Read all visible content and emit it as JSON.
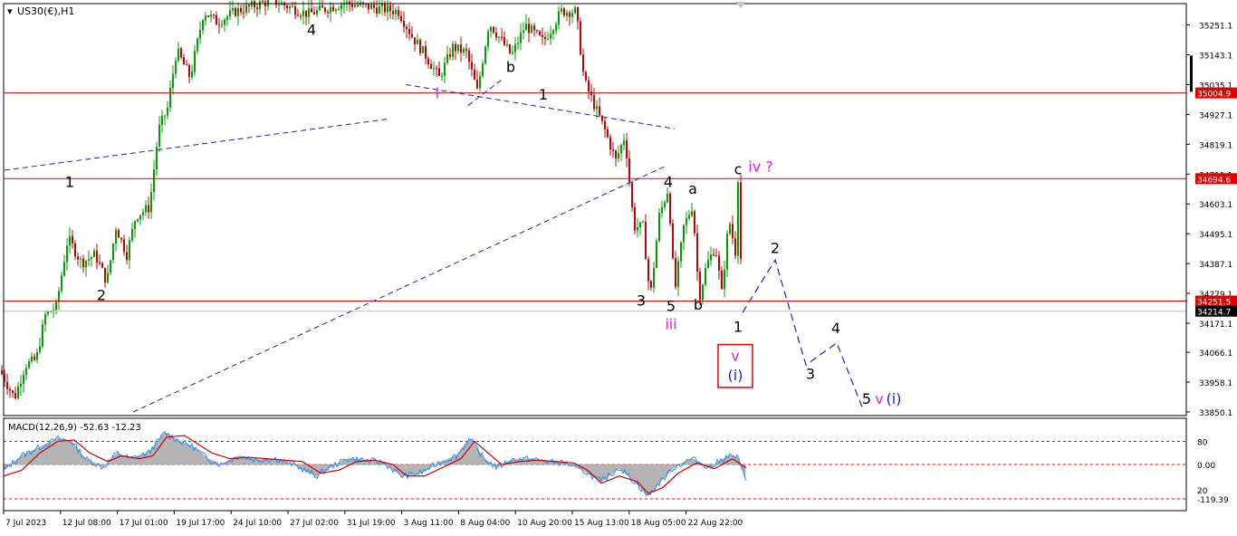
{
  "chart_title": "US30(€),H1",
  "indicator_label": "MACD(12,26,9) -52.63 -12.23",
  "colors": {
    "bull": "#00a000",
    "bear": "#c80000",
    "level_line": "#e00000",
    "trend_line": "#1e1ed2",
    "wave_label": "#000000",
    "wave_label_magenta": "#e020e0",
    "wave_label_blue": "#1e1ed2",
    "macd_hist": "#b4b4b4",
    "macd_line": "#1e90ff",
    "signal_line": "#d00000",
    "macd_level": "#ff0000",
    "frame": "#000000"
  },
  "chart_data": [
    {
      "type": "candlestick",
      "title": "US30(€),H1",
      "ylim": [
        33850,
        35315
      ],
      "y_ticks": [
        "35251.1",
        "35143.1",
        "35035.1",
        "34927.1",
        "34819.1",
        "34711.1",
        "34603.1",
        "34495.1",
        "34387.1",
        "34279.1",
        "34171.1",
        "34066.1",
        "33958.1",
        "33850.1"
      ],
      "x_tick_labels": [
        "7 Jul 2023",
        "12 Jul 08:00",
        "17 Jul 01:00",
        "19 Jul 17:00",
        "24 Jul 10:00",
        "27 Jul 02:00",
        "31 Jul 19:00",
        "3 Aug 11:00",
        "8 Aug 04:00",
        "10 Aug 20:00",
        "15 Aug 13:00",
        "18 Aug 05:00",
        "22 Aug 22:00"
      ],
      "price_path": [
        [
          0,
          34000
        ],
        [
          8,
          33950
        ],
        [
          16,
          33900
        ],
        [
          28,
          34020
        ],
        [
          40,
          34040
        ],
        [
          50,
          34200
        ],
        [
          62,
          34230
        ],
        [
          75,
          34480
        ],
        [
          90,
          34390
        ],
        [
          105,
          34420
        ],
        [
          118,
          34320
        ],
        [
          128,
          34520
        ],
        [
          140,
          34420
        ],
        [
          150,
          34560
        ],
        [
          165,
          34590
        ],
        [
          175,
          34870
        ],
        [
          185,
          34950
        ],
        [
          195,
          35160
        ],
        [
          210,
          35060
        ],
        [
          225,
          35300
        ],
        [
          240,
          35260
        ],
        [
          260,
          35300
        ],
        [
          300,
          35340
        ],
        [
          340,
          35290
        ],
        [
          380,
          35330
        ],
        [
          440,
          35300
        ],
        [
          455,
          35210
        ],
        [
          470,
          35140
        ],
        [
          485,
          35060
        ],
        [
          500,
          35170
        ],
        [
          515,
          35150
        ],
        [
          527,
          35010
        ],
        [
          540,
          35260
        ],
        [
          565,
          35140
        ],
        [
          580,
          35250
        ],
        [
          600,
          35190
        ],
        [
          620,
          35300
        ],
        [
          636,
          35300
        ],
        [
          645,
          35050
        ],
        [
          655,
          34970
        ],
        [
          668,
          34870
        ],
        [
          680,
          34760
        ],
        [
          690,
          34850
        ],
        [
          700,
          34520
        ],
        [
          710,
          34520
        ],
        [
          718,
          34260
        ],
        [
          728,
          34560
        ],
        [
          738,
          34660
        ],
        [
          745,
          34280
        ],
        [
          755,
          34520
        ],
        [
          765,
          34600
        ],
        [
          772,
          34260
        ],
        [
          780,
          34380
        ],
        [
          790,
          34450
        ],
        [
          797,
          34280
        ],
        [
          805,
          34550
        ],
        [
          812,
          34430
        ],
        [
          815,
          34700
        ],
        [
          820,
          34210
        ]
      ],
      "levels": [
        {
          "price": 35004.9,
          "label": "35004.9"
        },
        {
          "price": 34694.6,
          "label": "34694.6"
        },
        {
          "price": 34251.5,
          "label": "34251.5"
        }
      ],
      "current_price": {
        "price": 34214.7,
        "label": "34214.7"
      },
      "trend_lines": [
        {
          "from": [
            5,
            34725
          ],
          "to": [
            428,
            34910
          ]
        },
        {
          "from": [
            448,
            35035
          ],
          "to": [
            745,
            34875
          ]
        },
        {
          "from": [
            147,
            33850
          ],
          "to": [
            735,
            34740
          ]
        },
        {
          "from": [
            517,
            34960
          ],
          "to": [
            555,
            35055
          ]
        }
      ],
      "projection": [
        [
          820,
          34210
        ],
        [
          856,
          34400
        ],
        [
          890,
          34020
        ],
        [
          924,
          34100
        ],
        [
          953,
          33860
        ]
      ],
      "wave_labels": [
        {
          "text": "1",
          "x": 77,
          "price": 34665,
          "style": "black"
        },
        {
          "text": "2",
          "x": 112,
          "price": 34255,
          "style": "black"
        },
        {
          "text": "4",
          "x": 344,
          "price": 35215,
          "style": "black"
        },
        {
          "text": "i",
          "x": 483,
          "price": 34985,
          "style": "magenta"
        },
        {
          "text": "b",
          "x": 564,
          "price": 35080,
          "style": "black"
        },
        {
          "text": "1",
          "x": 600,
          "price": 34980,
          "style": "black"
        },
        {
          "text": "4",
          "x": 738,
          "price": 34665,
          "style": "black"
        },
        {
          "text": "a",
          "x": 765,
          "price": 34640,
          "style": "black"
        },
        {
          "text": "c",
          "x": 815,
          "price": 34710,
          "style": "black"
        },
        {
          "text": "iv ?",
          "x": 840,
          "price": 34720,
          "style": "magenta"
        },
        {
          "text": "2",
          "x": 856,
          "price": 34425,
          "style": "black"
        },
        {
          "text": "3",
          "x": 708,
          "price": 34235,
          "style": "black"
        },
        {
          "text": "5",
          "x": 741,
          "price": 34215,
          "style": "black"
        },
        {
          "text": "b",
          "x": 771,
          "price": 34220,
          "style": "black"
        },
        {
          "text": "iii",
          "x": 741,
          "price": 34150,
          "style": "magenta"
        },
        {
          "text": "1",
          "x": 815,
          "price": 34140,
          "style": "black"
        },
        {
          "text": "4",
          "x": 923,
          "price": 34135,
          "style": "black"
        },
        {
          "text": "3",
          "x": 895,
          "price": 33970,
          "style": "black"
        },
        {
          "text": "5",
          "x": 957,
          "price": 33880,
          "style": "black"
        },
        {
          "text": "v",
          "x": 971,
          "price": 33880,
          "style": "magenta"
        },
        {
          "text": "(i)",
          "x": 987,
          "price": 33880,
          "style": "blue"
        }
      ],
      "boxed_label": {
        "text_top": "v",
        "text_bottom": "(i)",
        "x": 812,
        "price_top": 34035,
        "price_bottom": 33965
      }
    },
    {
      "type": "bar",
      "title": "MACD(12,26,9) -52.63 -12.23",
      "ylim": [
        -160,
        160
      ],
      "y_ticks": [
        "80",
        "0.00",
        "-119.39"
      ],
      "y_tick_overlay": [
        "20"
      ],
      "levels": [
        80,
        0,
        -119.39
      ],
      "histogram_path": [
        [
          0,
          -20
        ],
        [
          20,
          30
        ],
        [
          40,
          60
        ],
        [
          60,
          90
        ],
        [
          75,
          80
        ],
        [
          90,
          20
        ],
        [
          110,
          -10
        ],
        [
          125,
          40
        ],
        [
          140,
          20
        ],
        [
          160,
          40
        ],
        [
          178,
          110
        ],
        [
          195,
          80
        ],
        [
          210,
          60
        ],
        [
          225,
          20
        ],
        [
          240,
          0
        ],
        [
          260,
          30
        ],
        [
          280,
          15
        ],
        [
          300,
          20
        ],
        [
          320,
          0
        ],
        [
          345,
          -40
        ],
        [
          360,
          -10
        ],
        [
          380,
          20
        ],
        [
          400,
          15
        ],
        [
          420,
          5
        ],
        [
          440,
          -40
        ],
        [
          460,
          -30
        ],
        [
          480,
          5
        ],
        [
          500,
          30
        ],
        [
          515,
          90
        ],
        [
          530,
          20
        ],
        [
          545,
          -10
        ],
        [
          560,
          15
        ],
        [
          580,
          20
        ],
        [
          600,
          10
        ],
        [
          620,
          5
        ],
        [
          640,
          -20
        ],
        [
          660,
          -60
        ],
        [
          680,
          -10
        ],
        [
          700,
          -70
        ],
        [
          712,
          -110
        ],
        [
          725,
          -60
        ],
        [
          740,
          -10
        ],
        [
          760,
          20
        ],
        [
          780,
          -10
        ],
        [
          800,
          30
        ],
        [
          810,
          25
        ],
        [
          820,
          -52
        ]
      ],
      "signal_path": [
        [
          0,
          -40
        ],
        [
          20,
          -20
        ],
        [
          40,
          40
        ],
        [
          60,
          80
        ],
        [
          78,
          85
        ],
        [
          95,
          40
        ],
        [
          115,
          10
        ],
        [
          130,
          30
        ],
        [
          150,
          20
        ],
        [
          165,
          30
        ],
        [
          180,
          95
        ],
        [
          200,
          100
        ],
        [
          215,
          70
        ],
        [
          230,
          40
        ],
        [
          250,
          20
        ],
        [
          270,
          25
        ],
        [
          290,
          20
        ],
        [
          310,
          15
        ],
        [
          330,
          10
        ],
        [
          350,
          -30
        ],
        [
          370,
          -20
        ],
        [
          390,
          10
        ],
        [
          410,
          15
        ],
        [
          430,
          0
        ],
        [
          445,
          -40
        ],
        [
          465,
          -40
        ],
        [
          485,
          -10
        ],
        [
          505,
          20
        ],
        [
          520,
          80
        ],
        [
          535,
          40
        ],
        [
          550,
          0
        ],
        [
          570,
          10
        ],
        [
          590,
          15
        ],
        [
          610,
          10
        ],
        [
          630,
          5
        ],
        [
          645,
          -20
        ],
        [
          660,
          -65
        ],
        [
          680,
          -40
        ],
        [
          700,
          -60
        ],
        [
          712,
          -100
        ],
        [
          728,
          -80
        ],
        [
          745,
          -30
        ],
        [
          765,
          5
        ],
        [
          785,
          -15
        ],
        [
          805,
          20
        ],
        [
          820,
          -12
        ]
      ],
      "noise_amplitude": 22
    }
  ]
}
